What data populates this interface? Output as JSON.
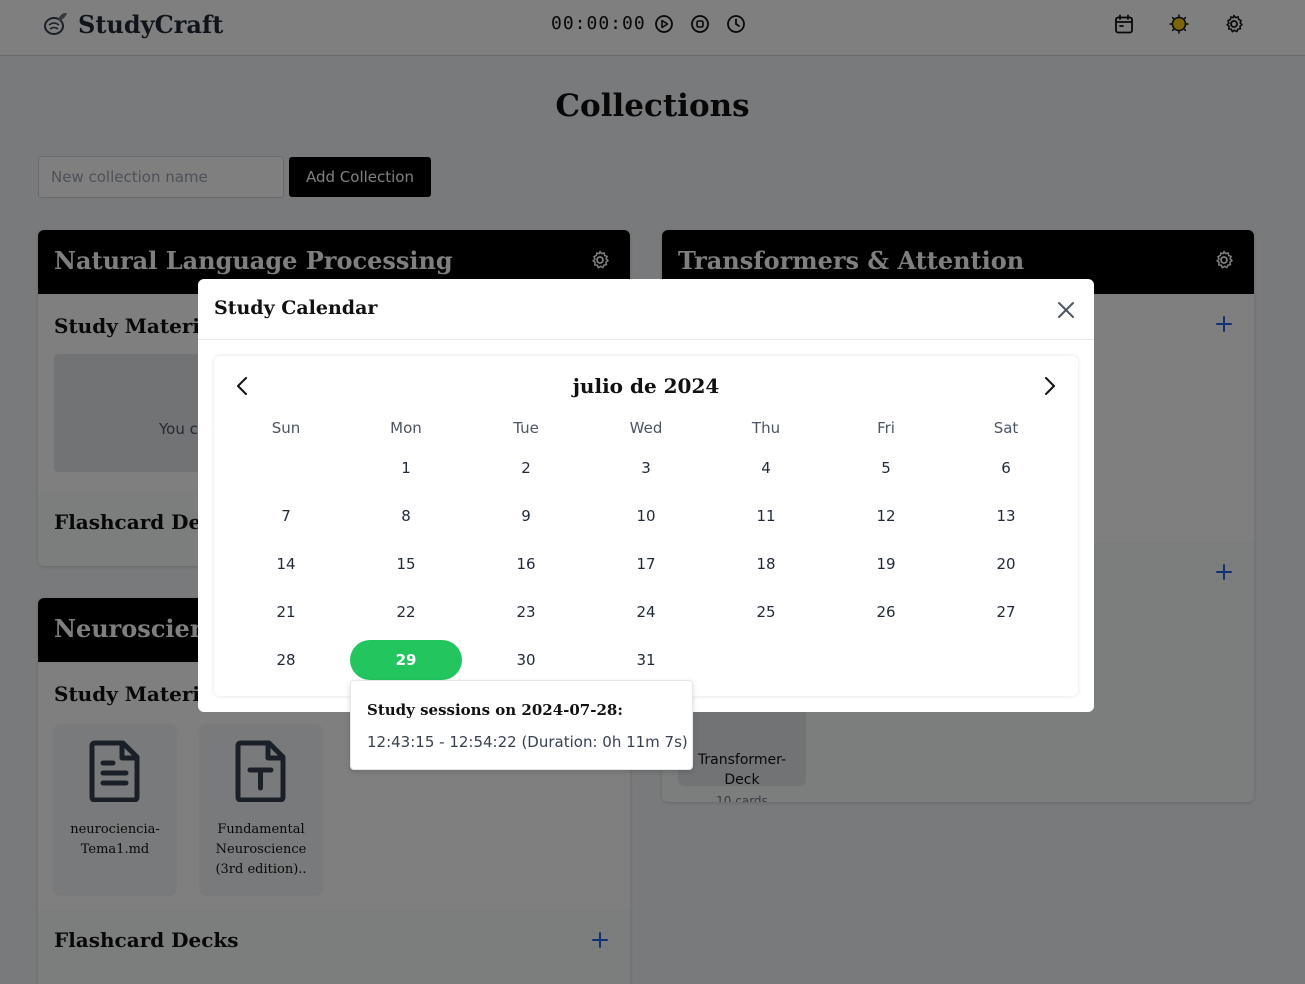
{
  "header": {
    "brand": "StudyCraft",
    "timer": "00:00:00",
    "icons": [
      "brain-leaf-logo-icon",
      "play-icon",
      "stop-icon",
      "clock-icon",
      "calendar-icon",
      "sun-icon",
      "gear-icon"
    ]
  },
  "page": {
    "title": "Collections",
    "new_collection_placeholder": "New collection name",
    "add_collection_label": "Add Collection"
  },
  "collections": [
    {
      "title": "Natural Language Processing",
      "study_materials_label": "Study Materials",
      "empty_text": "You c",
      "flashcards_label": "Flashcard Decks"
    },
    {
      "title": "Transformers & Attention",
      "deck": {
        "name_line1": "Transformer-",
        "name_line2": "Deck",
        "count": "10 cards"
      }
    },
    {
      "title": "Neuroscience",
      "study_materials_label": "Study Materials",
      "materials": [
        {
          "line1": "neurociencia-",
          "line2": "Tema1.md",
          "line3": ""
        },
        {
          "line1": "Fundamental",
          "line2": "Neuroscience",
          "line3": "(3rd edition).."
        }
      ],
      "flashcards_label": "Flashcard Decks"
    }
  ],
  "modal": {
    "title": "Study Calendar",
    "month": "julio de 2024",
    "weekdays": [
      "Sun",
      "Mon",
      "Tue",
      "Wed",
      "Thu",
      "Fri",
      "Sat"
    ],
    "first_weekday_index": 1,
    "days_in_month": 31,
    "selected_day": 29,
    "tooltip_title": "Study sessions on 2024-07-28:",
    "tooltip_text": "12:43:15 - 12:54:22 (Duration: 0h 11m 7s)"
  },
  "colors": {
    "accent_blue": "#2563eb",
    "selected_green": "#22c55e",
    "header_black": "#000000"
  }
}
